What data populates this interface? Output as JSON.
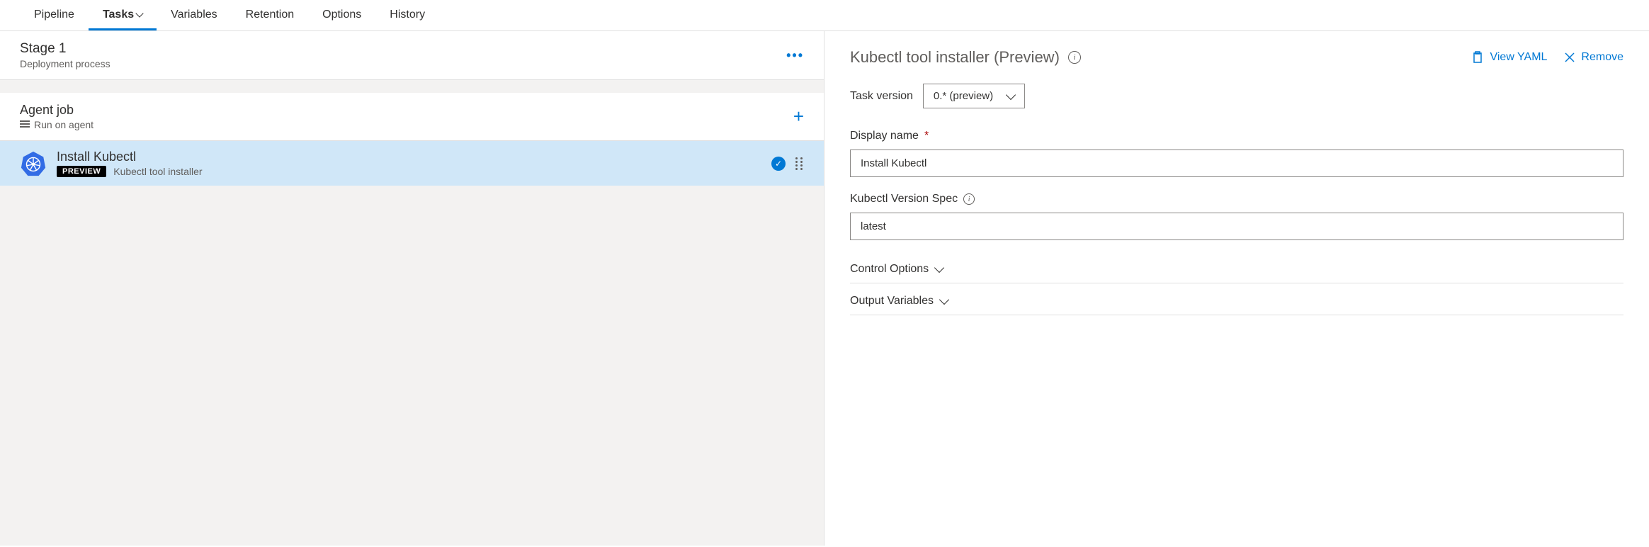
{
  "tabs": {
    "pipeline": "Pipeline",
    "tasks": "Tasks",
    "variables": "Variables",
    "retention": "Retention",
    "options": "Options",
    "history": "History"
  },
  "stage": {
    "title": "Stage 1",
    "subtitle": "Deployment process"
  },
  "agent": {
    "title": "Agent job",
    "subtitle": "Run on agent"
  },
  "task": {
    "title": "Install Kubectl",
    "preview_badge": "PREVIEW",
    "description": "Kubectl tool installer"
  },
  "detail": {
    "title": "Kubectl tool installer (Preview)",
    "view_yaml": "View YAML",
    "remove": "Remove",
    "task_version_label": "Task version",
    "task_version_value": "0.* (preview)",
    "display_name_label": "Display name",
    "display_name_value": "Install Kubectl",
    "version_spec_label": "Kubectl Version Spec",
    "version_spec_value": "latest",
    "control_options": "Control Options",
    "output_variables": "Output Variables"
  }
}
